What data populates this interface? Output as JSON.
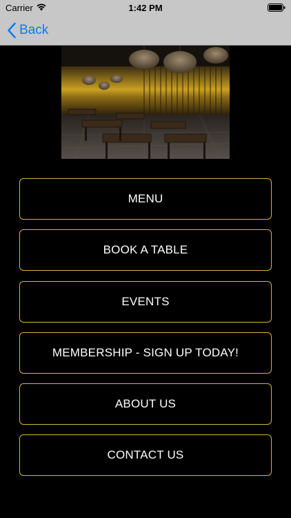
{
  "status_bar": {
    "carrier": "Carrier",
    "time": "1:42 PM",
    "wifi_icon": "wifi-icon",
    "battery_icon": "battery-icon"
  },
  "nav": {
    "back_label": "Back",
    "back_icon": "chevron-left-icon"
  },
  "colors": {
    "background": "#000000",
    "topbar": "#c7c7c7",
    "accent_border": "#d9b43a",
    "button_text": "#ffffff",
    "link": "#0a7aff"
  },
  "buttons": [
    {
      "label": "MENU"
    },
    {
      "label": "BOOK A TABLE"
    },
    {
      "label": "EVENTS"
    },
    {
      "label": "MEMBERSHIP - SIGN UP TODAY!"
    },
    {
      "label": "ABOUT US"
    },
    {
      "label": "CONTACT US"
    }
  ]
}
